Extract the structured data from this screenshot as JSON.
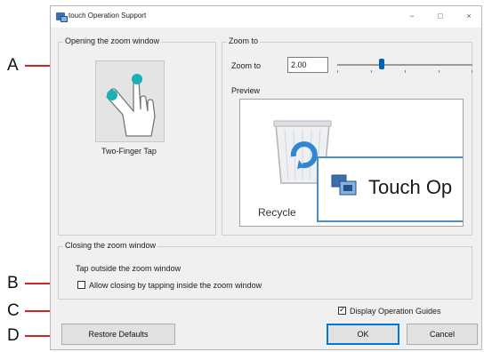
{
  "window": {
    "title": "touch Operation Support",
    "minimize": "−",
    "maximize": "□",
    "close": "×"
  },
  "opening_group": {
    "title": "Opening the zoom window",
    "gesture_label": "Two-Finger Tap"
  },
  "zoom_group": {
    "title": "Zoom to",
    "zoom_label": "Zoom to",
    "zoom_value": "2.00",
    "slider_level_fraction": 0.33,
    "preview_label": "Preview",
    "preview_popup_text": "Touch Op",
    "preview_icon_label": "Recycle"
  },
  "closing_group": {
    "title": "Closing the zoom window",
    "tap_outside_text": "Tap outside the zoom window",
    "allow_closing_label": "Allow closing by tapping inside the zoom window",
    "allow_closing_checked": false
  },
  "display_guides": {
    "label": "Display Operation Guides",
    "checked": true
  },
  "buttons": {
    "restore": "Restore Defaults",
    "ok": "OK",
    "cancel": "Cancel"
  },
  "callouts": [
    "A",
    "B",
    "C",
    "D"
  ],
  "colors": {
    "callout_line": "#d2232a",
    "accent": "#0078d7",
    "touch_dot": "#1ab0b8"
  }
}
